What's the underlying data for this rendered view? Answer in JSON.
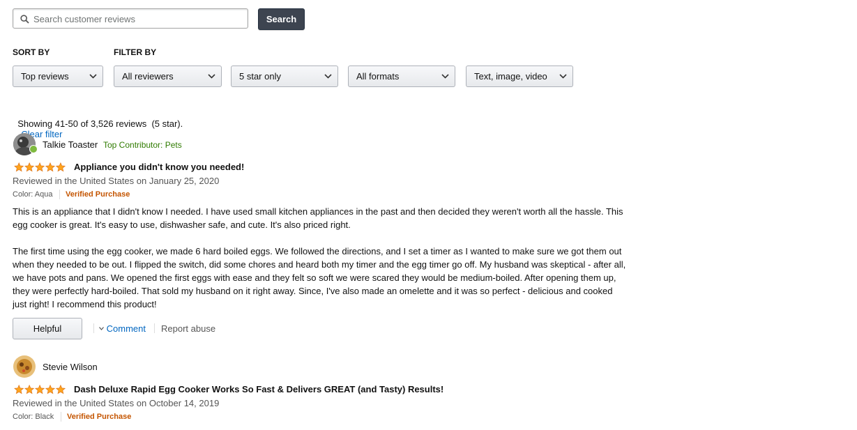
{
  "search": {
    "placeholder": "Search customer reviews",
    "button_label": "Search"
  },
  "sort_by_label": "SORT BY",
  "filter_by_label": "FILTER BY",
  "dropdowns": {
    "sort": "Top reviews",
    "reviewers": "All reviewers",
    "stars": "5 star only",
    "formats": "All formats",
    "media": "Text, image, video"
  },
  "summary": {
    "text": "Showing 41-50 of 3,526 reviews  (5 star).",
    "clear_filter": "Clear filter"
  },
  "reviews": [
    {
      "reviewer": "Talkie Toaster",
      "badge": "Top Contributor: Pets",
      "rating": 5,
      "title": "Appliance you didn't know you needed!",
      "date_line": "Reviewed in the United States on January 25, 2020",
      "color": "Color: Aqua",
      "verified": "Verified Purchase",
      "body_p1": "This is an appliance that I didn't know I needed. I have used small kitchen appliances in the past and then decided they weren't worth all the hassle. This egg cooker is great. It's easy to use, dishwasher safe, and cute. It's also priced right.",
      "body_p2": "The first time using the egg cooker, we made 6 hard boiled eggs. We followed the directions, and I set a timer as I wanted to make sure we got them out when they needed to be out. I flipped the switch, did some chores and heard both my timer and the egg timer go off. My husband was skeptical - after all, we have pots and pans. We opened the first eggs with ease and they felt so soft we were scared they would be medium-boiled. After opening them up, they were perfectly hard-boiled. That sold my husband on it right away. Since, I've also made an omelette and it was so perfect - delicious and cooked just right! I recommend this product!",
      "helpful_label": "Helpful",
      "comment_label": "Comment",
      "report_label": "Report abuse"
    },
    {
      "reviewer": "Stevie Wilson",
      "rating": 5,
      "title": "Dash Deluxe Rapid Egg Cooker Works So Fast & Delivers GREAT (and Tasty) Results!",
      "date_line": "Reviewed in the United States on October 14, 2019",
      "color": "Color: Black",
      "verified": "Verified Purchase"
    }
  ],
  "colors": {
    "link": "#0066c0",
    "star": "#ffa41c",
    "verified": "#c45500",
    "contributor": "#2f7b00"
  },
  "icons": [
    "search-icon",
    "chevron-down-icon",
    "star-icon",
    "avatar"
  ]
}
